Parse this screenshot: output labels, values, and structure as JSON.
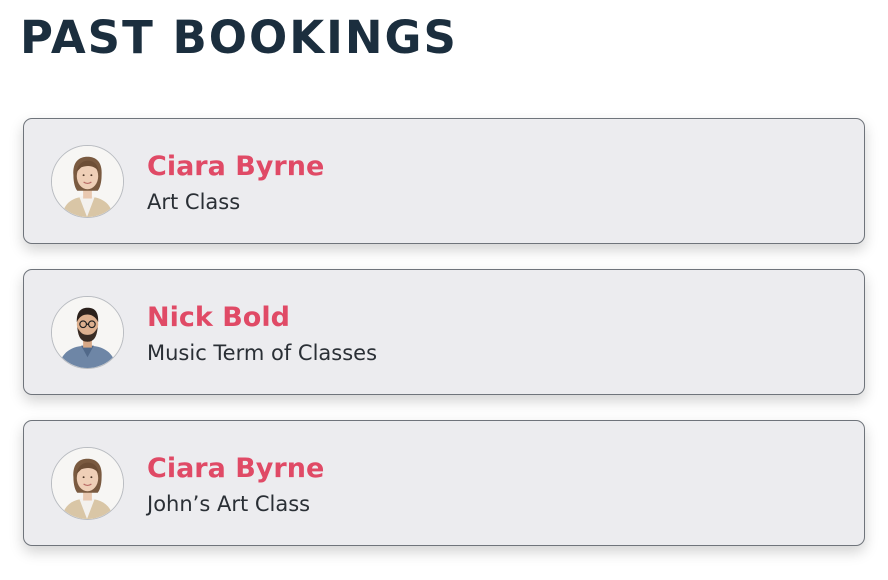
{
  "page": {
    "title": "PAST BOOKINGS"
  },
  "bookings": [
    {
      "name": "Ciara Byrne",
      "service": "Art Class",
      "avatar_icon": "woman-portrait-icon"
    },
    {
      "name": "Nick Bold",
      "service": "Music Term of Classes",
      "avatar_icon": "man-portrait-icon"
    },
    {
      "name": "Ciara Byrne",
      "service": "John’s Art Class",
      "avatar_icon": "woman-portrait-icon"
    }
  ],
  "colors": {
    "title": "#1b2e3e",
    "name_accent": "#e04a66",
    "card_background": "#ececef",
    "card_border": "#6f747b"
  }
}
